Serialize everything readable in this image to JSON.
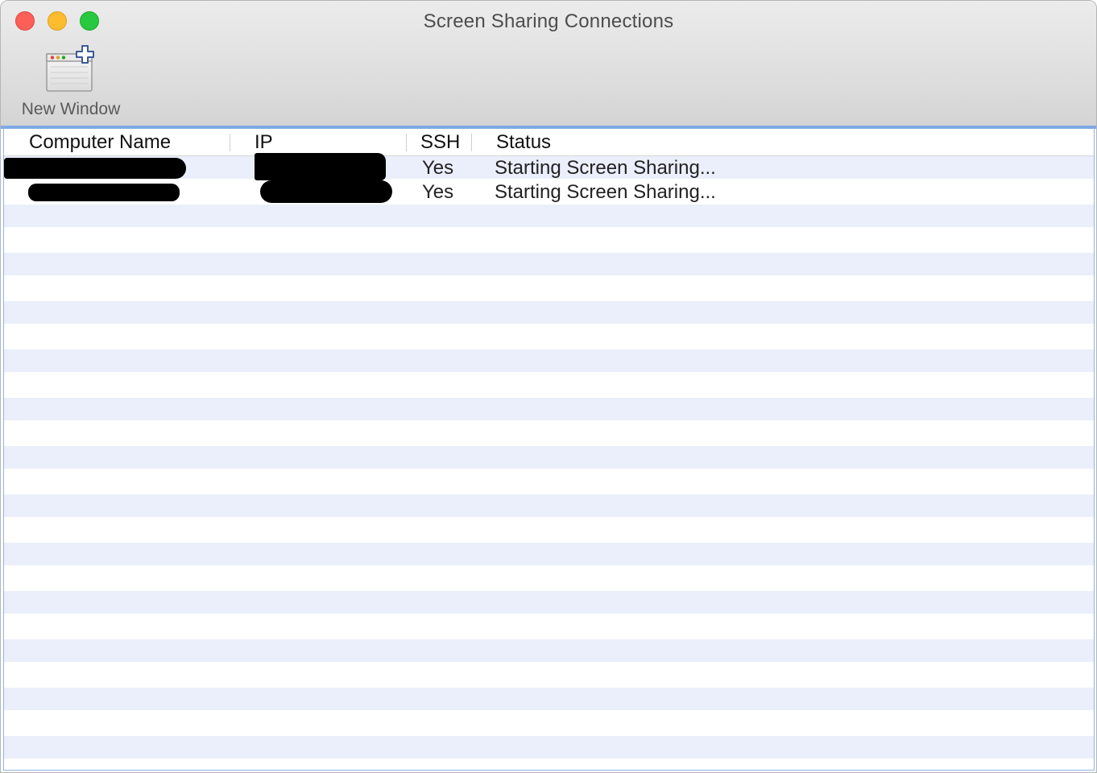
{
  "window": {
    "title": "Screen Sharing Connections"
  },
  "toolbar": {
    "new_window_label": "New Window",
    "new_window_icon": "new-window-icon"
  },
  "table": {
    "columns": [
      "Computer Name",
      "IP",
      "SSH",
      "Status"
    ],
    "rows": [
      {
        "computer_name": "",
        "ip": "",
        "ssh": "Yes",
        "status": "Starting Screen Sharing..."
      },
      {
        "computer_name": "",
        "ip": "",
        "ssh": "Yes",
        "status": "Starting Screen Sharing..."
      }
    ]
  },
  "colors": {
    "close": "#fc5f57",
    "minimize": "#fdbc2e",
    "zoom": "#28c840",
    "row_stripe": "#ebeffb",
    "focus_ring": "#7fa9e6"
  }
}
